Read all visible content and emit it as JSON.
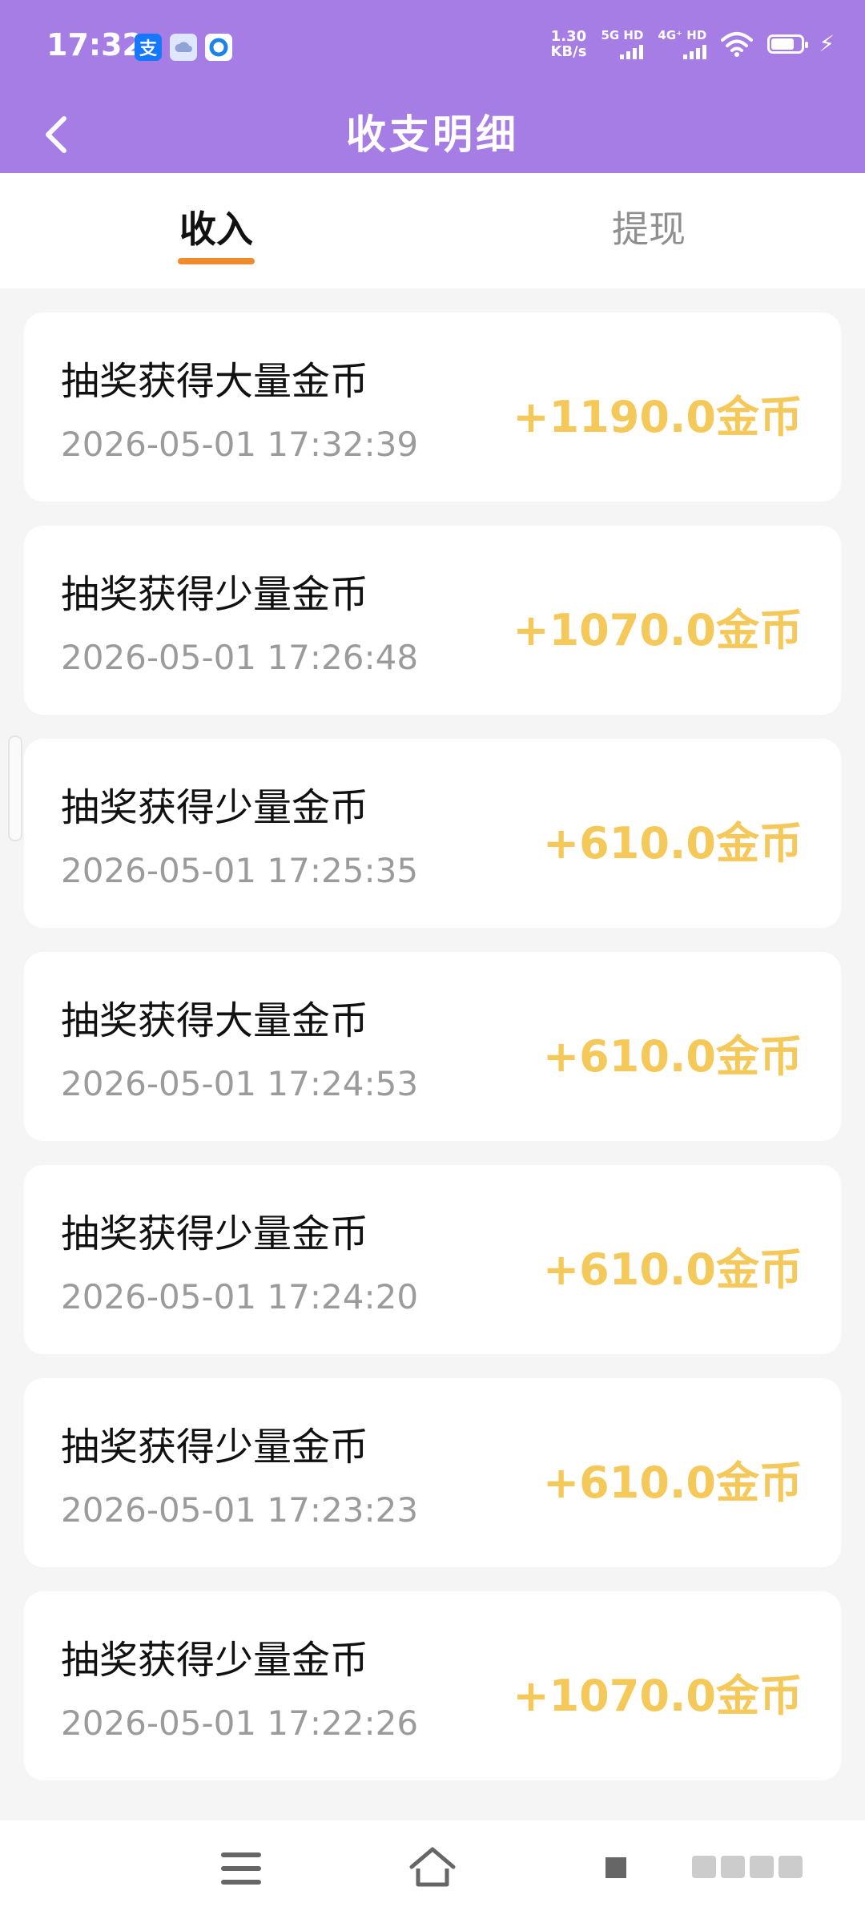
{
  "status": {
    "time": "17:32",
    "net_speed_value": "1.30",
    "net_speed_unit": "KB/s",
    "sim1_label": "5G HD",
    "sim2_label": "4G⁺ HD",
    "app_icons": [
      "alipay-icon",
      "cloud-icon",
      "circle-app-icon"
    ],
    "battery_level": 0.7
  },
  "appbar": {
    "title": "收支明细"
  },
  "tabs": [
    {
      "label": "收入",
      "active": true
    },
    {
      "label": "提现",
      "active": false
    }
  ],
  "colors": {
    "header": "#a67de4",
    "tab_indicator": "#ef8b2c",
    "amount": "#f5c85a"
  },
  "records": [
    {
      "title": "抽奖获得大量金币",
      "time": "2026-05-01 17:32:39",
      "amount": "+1190.0金币"
    },
    {
      "title": "抽奖获得少量金币",
      "time": "2026-05-01 17:26:48",
      "amount": "+1070.0金币"
    },
    {
      "title": "抽奖获得少量金币",
      "time": "2026-05-01 17:25:35",
      "amount": "+610.0金币"
    },
    {
      "title": "抽奖获得大量金币",
      "time": "2026-05-01 17:24:53",
      "amount": "+610.0金币"
    },
    {
      "title": "抽奖获得少量金币",
      "time": "2026-05-01 17:24:20",
      "amount": "+610.0金币"
    },
    {
      "title": "抽奖获得少量金币",
      "time": "2026-05-01 17:23:23",
      "amount": "+610.0金币"
    },
    {
      "title": "抽奖获得少量金币",
      "time": "2026-05-01 17:22:26",
      "amount": "+1070.0金币"
    }
  ]
}
